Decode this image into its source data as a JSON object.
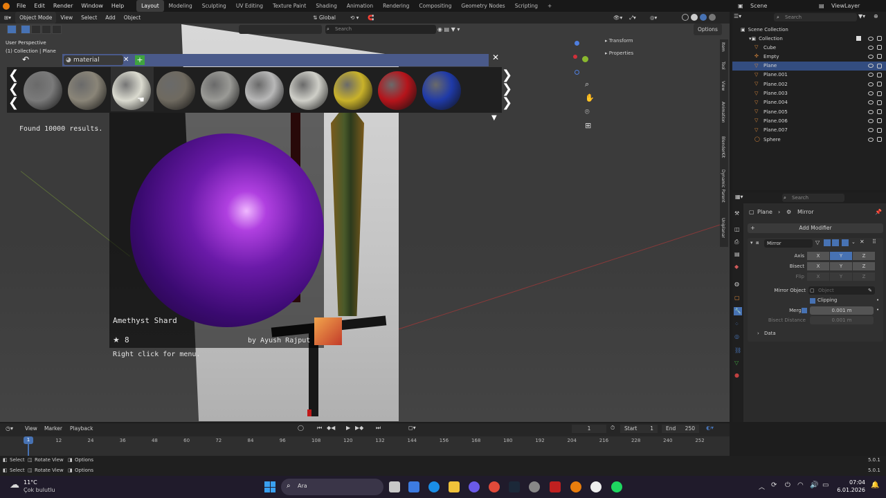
{
  "topmenu": {
    "items": [
      "File",
      "Edit",
      "Render",
      "Window",
      "Help"
    ],
    "workspaces": [
      "Layout",
      "Modeling",
      "Sculpting",
      "UV Editing",
      "Texture Paint",
      "Shading",
      "Animation",
      "Rendering",
      "Compositing",
      "Geometry Nodes",
      "Scripting"
    ],
    "active_workspace": "Layout",
    "add_tab": "+",
    "scene_label": "Scene",
    "viewlayer_label": "ViewLayer"
  },
  "viewport": {
    "mode": "Object Mode",
    "menu": [
      "View",
      "Select",
      "Add",
      "Object"
    ],
    "orientation": "Global",
    "search_placeholder": "Search",
    "options_label": "Options",
    "info_line1": "User Perspective",
    "info_line2": "(1) Collection | Plane",
    "n_panel": {
      "transform": "Transform",
      "properties": "Properties"
    },
    "side_tabs": [
      "Item",
      "Tool",
      "View",
      "Animation",
      "BlenderKit",
      "Dynamic Parent",
      "Uniplanar"
    ]
  },
  "asset_browser": {
    "search_value": "material",
    "add_label": "+",
    "close_label": "✕",
    "results_text": "Found 10000 results.",
    "asset_name": "Amethyst Shard",
    "rating": "8",
    "author": "by Ayush Rajput",
    "hint": "Right click for menu.",
    "thumbnails": [
      {
        "name": "stone-sphere",
        "color": "#7a7a7a"
      },
      {
        "name": "rough-metal-sphere",
        "color": "#8a8578"
      },
      {
        "name": "white-tile-sphere",
        "color": "#d8d8cc"
      },
      {
        "name": "dirt-sphere",
        "color": "#6f6a60"
      },
      {
        "name": "paver-sphere",
        "color": "#9a9a96"
      },
      {
        "name": "striped-sphere",
        "color": "#b8b8b8"
      },
      {
        "name": "white-pattern-sphere",
        "color": "#cfcfc8"
      },
      {
        "name": "yellow-lego-sphere",
        "color": "#c9b22a"
      },
      {
        "name": "red-sphere",
        "color": "#b5141b"
      },
      {
        "name": "blue-sphere",
        "color": "#1f3aa8"
      }
    ]
  },
  "outliner": {
    "search_placeholder": "Search",
    "root": "Scene Collection",
    "collection": "Collection",
    "items": [
      "Cube",
      "Empty",
      "Plane",
      "Plane.001",
      "Plane.002",
      "Plane.003",
      "Plane.004",
      "Plane.005",
      "Plane.006",
      "Plane.007",
      "Sphere"
    ],
    "selected": "Plane"
  },
  "properties": {
    "search_placeholder": "Search",
    "breadcrumb_object": "Plane",
    "breadcrumb_modifier": "Mirror",
    "add_modifier": "Add Modifier",
    "modifier_name": "Mirror",
    "axis_label": "Axis",
    "bisect_label": "Bisect",
    "flip_label": "Flip",
    "axes": [
      "X",
      "Y",
      "Z"
    ],
    "mirror_object_label": "Mirror Object",
    "object_placeholder": "Object",
    "clipping_label": "Clipping",
    "merge_label": "Merge",
    "merge_value": "0.001 m",
    "bisect_distance_label": "Bisect Distance",
    "bisect_distance_value": "0.001 m",
    "data_label": "Data"
  },
  "timeline": {
    "menu": [
      "View",
      "Marker",
      "Playback"
    ],
    "current_frame": "1",
    "start_label": "Start",
    "start_value": "1",
    "end_label": "End",
    "end_value": "250",
    "ticks": [
      "1",
      "12",
      "24",
      "36",
      "48",
      "60",
      "72",
      "84",
      "96",
      "108",
      "120",
      "132",
      "144",
      "156",
      "168",
      "180",
      "192",
      "204",
      "216",
      "228",
      "240",
      "252"
    ]
  },
  "statusbar": {
    "row1": [
      "Select",
      "Rotate View",
      "Options"
    ],
    "row2": [
      "Select",
      "Rotate View",
      "Options"
    ],
    "version": "5.0.1"
  },
  "taskbar": {
    "weather_temp": "11°C",
    "weather_desc": "Çok bulutlu",
    "search_label": "Ara",
    "time": "07:04",
    "date": "6.01.2026"
  },
  "colors": {
    "accent": "#4772b3",
    "selected": "#334d80",
    "add_green": "#3fa33f"
  }
}
